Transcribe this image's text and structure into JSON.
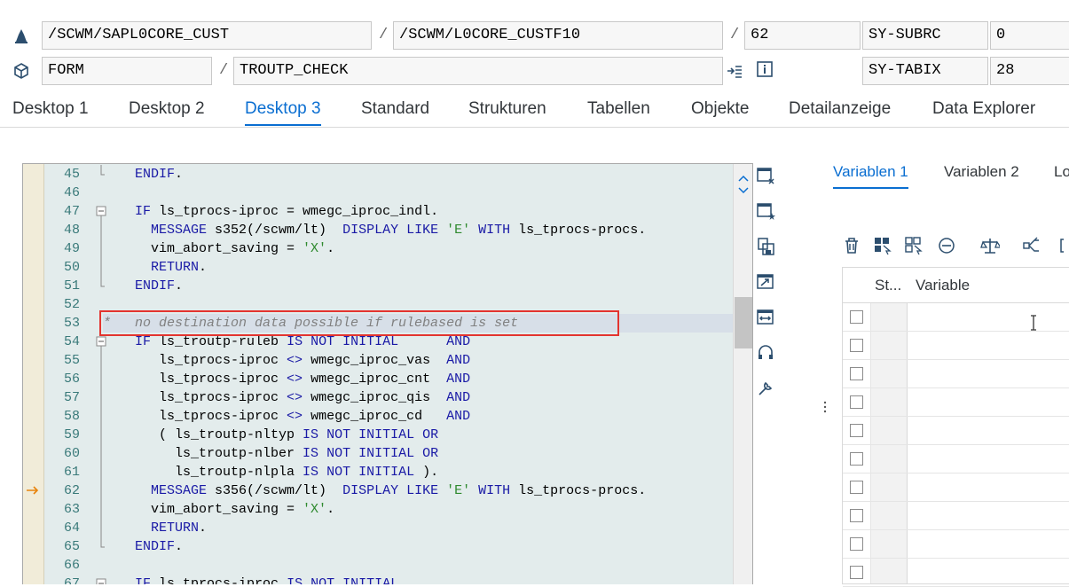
{
  "header": {
    "row1": {
      "program": "/SCWM/SAPL0CORE_CUST",
      "include": "/SCWM/L0CORE_CUSTF10",
      "line_no": "62",
      "sys_field": "SY-SUBRC",
      "sys_value": "0"
    },
    "row2": {
      "type": "FORM",
      "name": "TROUTP_CHECK",
      "sys_field": "SY-TABIX",
      "sys_value": "28"
    },
    "separator": "/"
  },
  "tabs": [
    "Desktop 1",
    "Desktop 2",
    "Desktop 3",
    "Standard",
    "Strukturen",
    "Tabellen",
    "Objekte",
    "Detailanzeige",
    "Data Explorer"
  ],
  "active_tab": "Desktop 3",
  "editor": {
    "current_line": 62,
    "highlight_line": 53,
    "lines": [
      {
        "n": "45",
        "fold": "end",
        "text": "    ENDIF."
      },
      {
        "n": "46",
        "fold": "",
        "text": ""
      },
      {
        "n": "47",
        "fold": "open",
        "text": "    IF ls_tprocs-iproc = wmegc_iproc_indl."
      },
      {
        "n": "48",
        "fold": "line",
        "text": "      MESSAGE s352(/scwm/lt)  DISPLAY LIKE 'E' WITH ls_tprocs-procs."
      },
      {
        "n": "49",
        "fold": "line",
        "text": "      vim_abort_saving = 'X'."
      },
      {
        "n": "50",
        "fold": "line",
        "text": "      RETURN."
      },
      {
        "n": "51",
        "fold": "end",
        "text": "    ENDIF."
      },
      {
        "n": "52",
        "fold": "",
        "text": ""
      },
      {
        "n": "53",
        "fold": "",
        "text": "*   no destination data possible if rulebased is set"
      },
      {
        "n": "54",
        "fold": "open",
        "text": "    IF ls_troutp-ruleb IS NOT INITIAL      AND"
      },
      {
        "n": "55",
        "fold": "line",
        "text": "       ls_tprocs-iproc <> wmegc_iproc_vas  AND"
      },
      {
        "n": "56",
        "fold": "line",
        "text": "       ls_tprocs-iproc <> wmegc_iproc_cnt  AND"
      },
      {
        "n": "57",
        "fold": "line",
        "text": "       ls_tprocs-iproc <> wmegc_iproc_qis  AND"
      },
      {
        "n": "58",
        "fold": "line",
        "text": "       ls_tprocs-iproc <> wmegc_iproc_cd   AND"
      },
      {
        "n": "59",
        "fold": "line",
        "text": "       ( ls_troutp-nltyp IS NOT INITIAL OR"
      },
      {
        "n": "60",
        "fold": "line",
        "text": "         ls_troutp-nlber IS NOT INITIAL OR"
      },
      {
        "n": "61",
        "fold": "line",
        "text": "         ls_troutp-nlpla IS NOT INITIAL )."
      },
      {
        "n": "62",
        "fold": "line",
        "text": "      MESSAGE s356(/scwm/lt)  DISPLAY LIKE 'E' WITH ls_tprocs-procs."
      },
      {
        "n": "63",
        "fold": "line",
        "text": "      vim_abort_saving = 'X'."
      },
      {
        "n": "64",
        "fold": "line",
        "text": "      RETURN."
      },
      {
        "n": "65",
        "fold": "end",
        "text": "    ENDIF."
      },
      {
        "n": "66",
        "fold": "",
        "text": ""
      },
      {
        "n": "67",
        "fold": "open",
        "text": "    IF ls_tprocs-iproc IS NOT INITIAL"
      }
    ]
  },
  "right_panel": {
    "tabs": [
      "Variablen 1",
      "Variablen 2",
      "Lo"
    ],
    "active_tab": "Variablen 1",
    "columns": [
      "St...",
      "Variable"
    ],
    "row_count": 10
  },
  "colors": {
    "accent": "#0a6ed1",
    "keyword": "#1a1aa6",
    "string": "#2f8a2f",
    "comment": "#808080",
    "highlight_box": "#e3342f",
    "execution_arrow": "#e8830c"
  }
}
